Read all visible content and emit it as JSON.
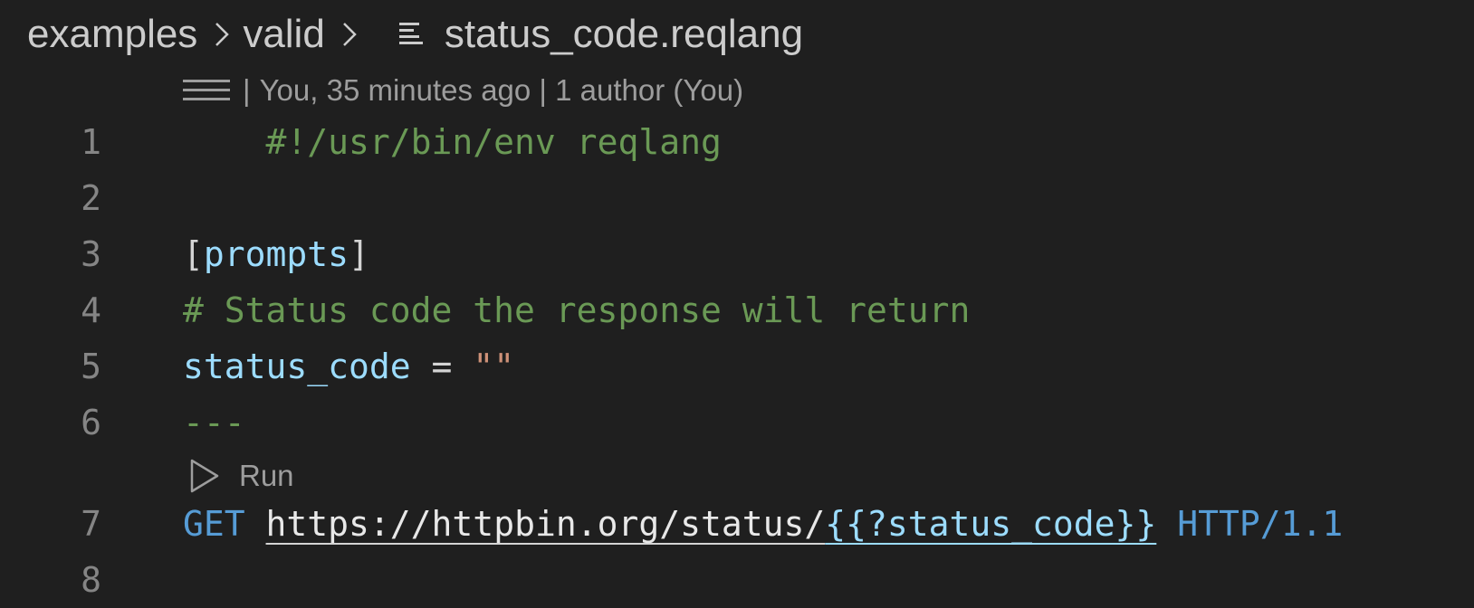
{
  "breadcrumb": {
    "items": [
      "examples",
      "valid"
    ],
    "file_name": "status_code.reqlang",
    "icons": {
      "separator": "chevron-right-icon",
      "file": "file-lines-icon"
    }
  },
  "blame": {
    "separator": "|",
    "text": "You, 35 minutes ago | 1 author (You)",
    "icon": "codelens-menu-icon"
  },
  "code_lens": {
    "run_label": "Run",
    "icon": "play-outline-icon"
  },
  "editor": {
    "lines": [
      {
        "number": "1",
        "shebang": "#!/usr/bin/env reqlang"
      },
      {
        "number": "2"
      },
      {
        "number": "3",
        "open_bracket": "[",
        "section": "prompts",
        "close_bracket": "]"
      },
      {
        "number": "4",
        "comment": "# Status code the response will return"
      },
      {
        "number": "5",
        "key": "status_code",
        "op": " = ",
        "value": "\"\""
      },
      {
        "number": "6",
        "delimiter": "---"
      },
      {
        "number": "7",
        "method": "GET",
        "url": "https://httpbin.org/status/",
        "template": "{{?status_code}}",
        "protocol": "HTTP/1.1"
      },
      {
        "number": "8"
      }
    ]
  },
  "colors": {
    "background": "#1f1f1f",
    "line_number": "#858585",
    "comment": "#6a9955",
    "key": "#9cdcfe",
    "string": "#ce9178",
    "keyword": "#569cd6"
  }
}
